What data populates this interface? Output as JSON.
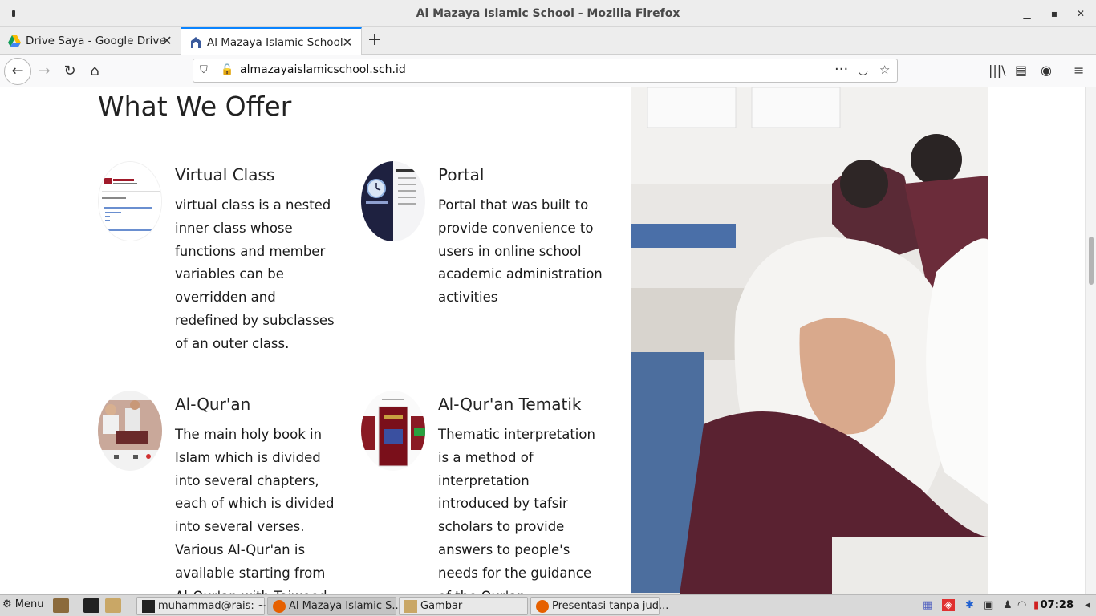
{
  "window": {
    "title": "Al Mazaya Islamic School - Mozilla Firefox"
  },
  "tabs": [
    {
      "label": "Drive Saya - Google Drive",
      "active": false
    },
    {
      "label": "Al Mazaya Islamic School",
      "active": true
    }
  ],
  "urlbar": {
    "url": "almazayaislamicschool.sch.id"
  },
  "page": {
    "heading": "What We Offer",
    "offers": [
      {
        "title": "Virtual Class",
        "description": "virtual class is a nested inner class whose functions and member variables can be overridden and redefined by subclasses of an outer class."
      },
      {
        "title": "Portal",
        "description": "Portal that was built to provide convenience to users in online school academic administration activities"
      },
      {
        "title": "Al-Qur'an",
        "description": "The main holy book in Islam which is divided into several chapters, each of which is divided into several verses. Various Al-Qur'an is available starting from Al-Qur'an with Tajweed"
      },
      {
        "title": "Al-Qur'an Tematik",
        "description": "Thematic interpretation is a method of interpretation introduced by tafsir scholars to provide answers to people's needs for the guidance of the Qur'an."
      }
    ]
  },
  "taskbar": {
    "menu_label": "Menu",
    "tasks": [
      {
        "label": "muhammad@rais: ~"
      },
      {
        "label": "Al Mazaya Islamic S..."
      },
      {
        "label": "Gambar"
      },
      {
        "label": "Presentasi tanpa jud..."
      }
    ],
    "clock": "07:28"
  },
  "colors": {
    "accent": "#0a84ff",
    "uniform": "#5a2231"
  }
}
